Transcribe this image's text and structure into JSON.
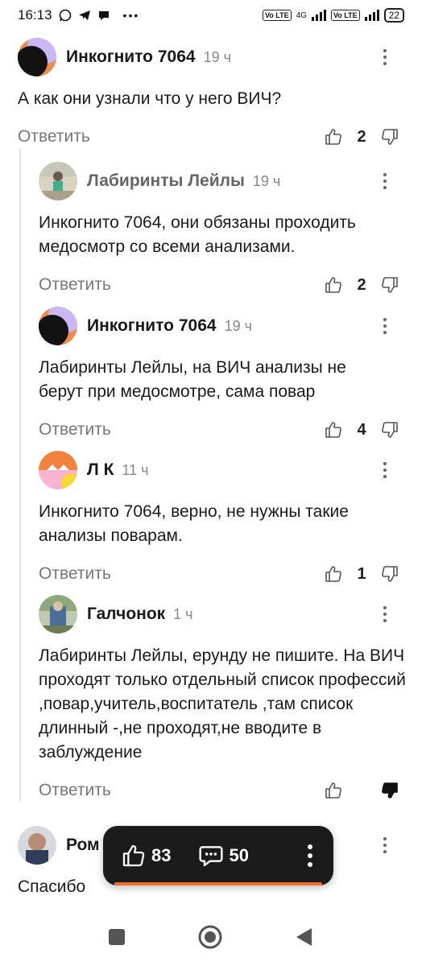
{
  "status_bar": {
    "time": "16:13",
    "network": "4G",
    "volte1": "Vo LTE",
    "volte2": "Vo LTE",
    "battery": "22",
    "dots": "•••"
  },
  "reply_label": "Ответить",
  "comments": [
    {
      "author": "Инкогнито 7064",
      "time": "19 ч",
      "text": "А как они узнали что у него ВИЧ?",
      "likes": "2",
      "avatar": "dark-orange"
    },
    {
      "author": "Лабиринты Лейлы",
      "time": "19 ч",
      "text": "Инкогнито 7064, они обязаны проходить медосмотр со всеми анализами.",
      "likes": "2",
      "avatar": "photo-green"
    },
    {
      "author": "Инкогнито 7064",
      "time": "19 ч",
      "text": "Лабиринты Лейлы, на ВИЧ анализы не берут при медосмотре, сама повар",
      "likes": "4",
      "avatar": "dark-orange"
    },
    {
      "author": "Л К",
      "time": "11 ч",
      "text": "Инкогнито 7064, верно, не нужны такие анализы поварам.",
      "likes": "1",
      "avatar": "orange-pink"
    },
    {
      "author": "Галчонок",
      "time": "1 ч",
      "text": "Лабиринты Лейлы, ерунду не пишите. На ВИЧ проходят только отдельный список профессий ,повар,учитель,воспитатель ,там список длинный -,не проходят,не вводите в заблуждение",
      "likes": "",
      "disliked": true,
      "avatar": "photo-blue"
    },
    {
      "author": "Ром",
      "time": "",
      "text": "Спасибо",
      "likes": "",
      "avatar": "photo-man"
    }
  ],
  "float_bar": {
    "likes": "83",
    "comments": "50"
  },
  "colors": {
    "accent": "#f46e2f",
    "dark": "#1b1b1b",
    "muted": "#888888"
  }
}
